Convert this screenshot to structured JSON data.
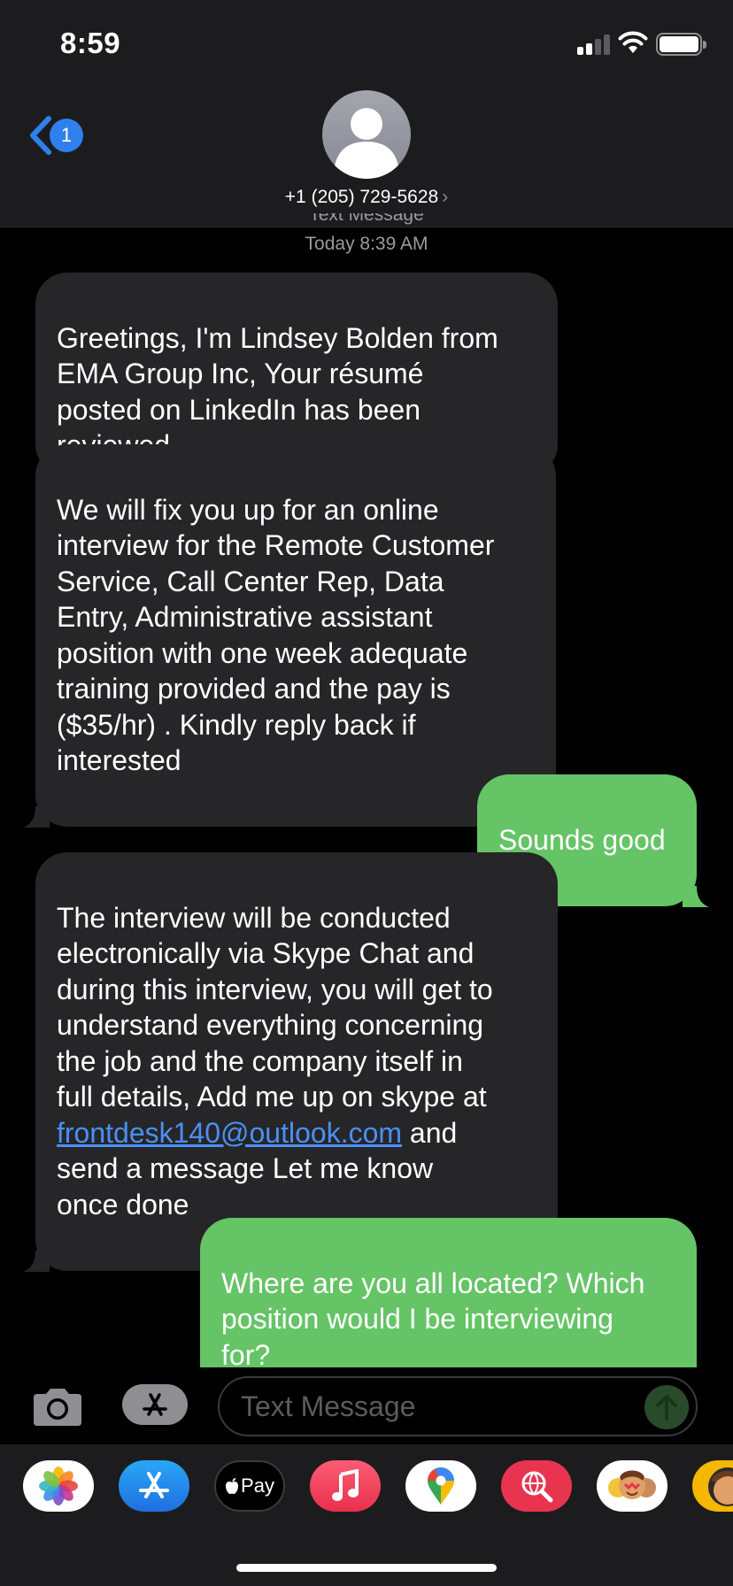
{
  "status_bar": {
    "time": "8:59",
    "signal_bars": 2,
    "battery_level": 1.0
  },
  "header": {
    "back_badge": "1",
    "contact": "+1 (205) 729-5628",
    "chevron": "›"
  },
  "thread": {
    "service_label": "Text Message",
    "timestamp": "Today 8:39 AM",
    "messages": [
      {
        "side": "incoming",
        "text": "Greetings, I'm Lindsey Bolden from\nEMA Group Inc, Your résumé\nposted on LinkedIn has been\nreviewed,"
      },
      {
        "side": "incoming",
        "text": "We will fix you up for an online\ninterview for the Remote Customer\nService, Call Center Rep, Data\nEntry, Administrative assistant\nposition with one week adequate\ntraining provided and the pay is\n($35/hr) . Kindly reply back if\ninterested"
      },
      {
        "side": "outgoing",
        "text": "Sounds good"
      },
      {
        "side": "incoming",
        "text_before": "The interview will be conducted\nelectronically via Skype Chat  and\nduring this interview, you will get to\nunderstand everything concerning\nthe job and the company itself in\nfull details, Add me up on skype at\n",
        "link": "frontdesk140@outlook.com",
        "text_after": " and\nsend a message   Let me know\nonce done"
      },
      {
        "side": "outgoing",
        "text": "Where are you all located? Which\nposition would I be interviewing\nfor?"
      }
    ]
  },
  "composer": {
    "placeholder": "Text Message"
  },
  "app_drawer": {
    "apps": [
      {
        "name": "photos-app-icon",
        "label": ""
      },
      {
        "name": "app-store-app-icon",
        "label": ""
      },
      {
        "name": "apple-pay-app-icon",
        "label": "Pay"
      },
      {
        "name": "music-app-icon",
        "label": ""
      },
      {
        "name": "google-maps-app-icon",
        "label": ""
      },
      {
        "name": "web-search-app-icon",
        "label": ""
      },
      {
        "name": "memoji-stickers-app-icon",
        "label": ""
      },
      {
        "name": "memoji-app-icon",
        "label": ""
      }
    ]
  },
  "colors": {
    "accent_blue": "#2f80ed",
    "link_blue": "#4a90f7",
    "outgoing_bubble": "#65c466",
    "incoming_bubble": "#262628",
    "header_bg": "#1c1c1e"
  }
}
